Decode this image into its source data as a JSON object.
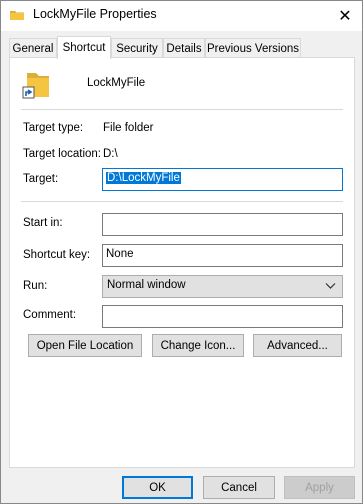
{
  "window": {
    "title": "LockMyFile Properties",
    "close_icon": "close-icon"
  },
  "tabs": [
    {
      "label": "General"
    },
    {
      "label": "Shortcut"
    },
    {
      "label": "Security"
    },
    {
      "label": "Details"
    },
    {
      "label": "Previous Versions"
    }
  ],
  "shortcut": {
    "name": "LockMyFile",
    "target_type_label": "Target type:",
    "target_type_value": "File folder",
    "target_location_label": "Target location:",
    "target_location_value": "D:\\",
    "target_label": "Target:",
    "target_value": "D:\\LockMyFile",
    "start_in_label": "Start in:",
    "start_in_value": "",
    "shortcut_key_label": "Shortcut key:",
    "shortcut_key_value": "None",
    "run_label": "Run:",
    "run_value": "Normal window",
    "comment_label": "Comment:",
    "comment_value": ""
  },
  "buttons": {
    "open_file_location": "Open File Location",
    "change_icon": "Change Icon...",
    "advanced": "Advanced...",
    "ok": "OK",
    "cancel": "Cancel",
    "apply": "Apply"
  },
  "colors": {
    "accent": "#0078d7",
    "folder": "#f5c542"
  }
}
